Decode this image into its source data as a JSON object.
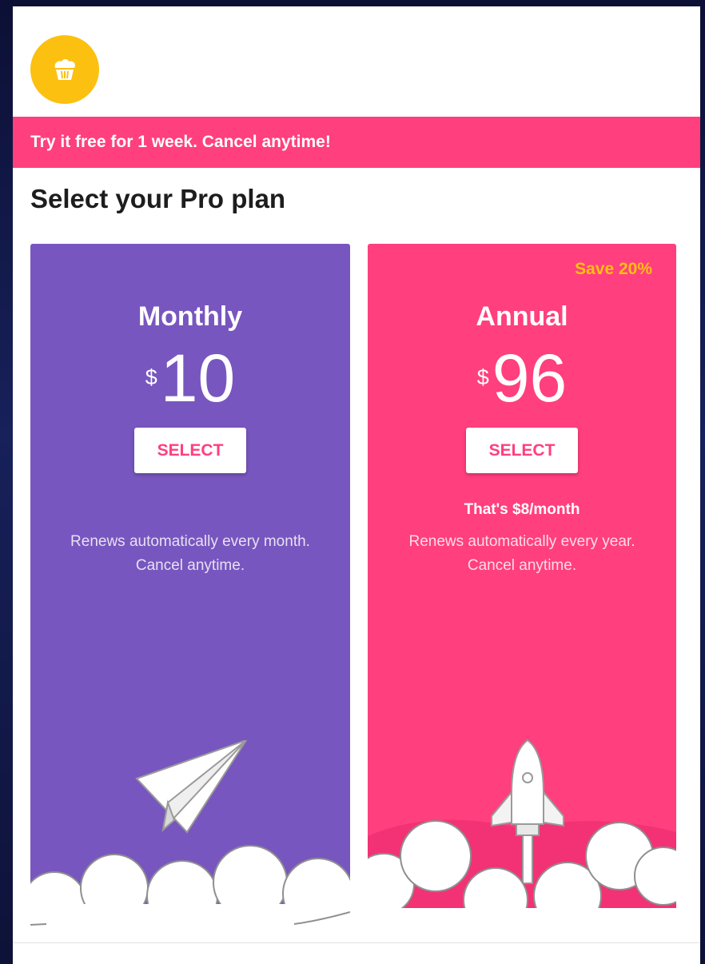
{
  "banner": {
    "text": "Try it free for 1 week. Cancel anytime!"
  },
  "heading": "Select your Pro plan",
  "plans": [
    {
      "title": "Monthly",
      "currency": "$",
      "amount": "10",
      "button": "SELECT",
      "renew_line1": "Renews automatically every month.",
      "renew_line2": "Cancel anytime.",
      "illustration": "paper-plane",
      "color": "#7856bf"
    },
    {
      "title": "Annual",
      "currency": "$",
      "amount": "96",
      "badge": "Save 20%",
      "button": "SELECT",
      "per_month": "That's $8/month",
      "renew_line1": "Renews automatically every year.",
      "renew_line2": "Cancel anytime.",
      "illustration": "rocket",
      "color": "#ff3f7e"
    }
  ],
  "logo_icon": "cupcake-icon",
  "colors": {
    "accent": "#ff3f7e",
    "purple": "#7856bf",
    "yellow": "#fcc010"
  }
}
